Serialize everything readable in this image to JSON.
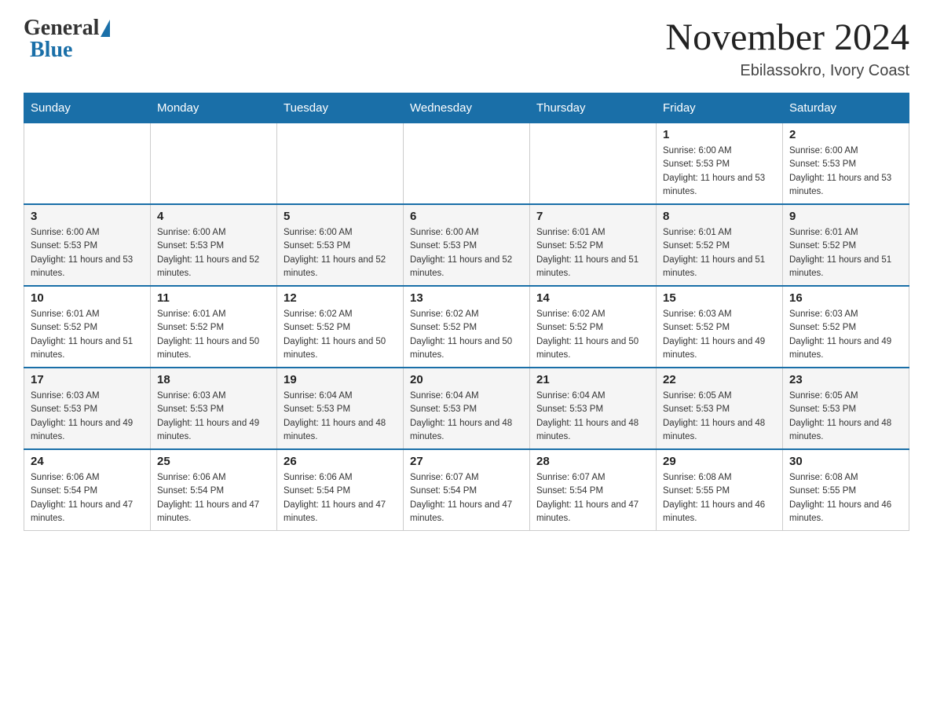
{
  "header": {
    "logo_general": "General",
    "logo_blue": "Blue",
    "month_title": "November 2024",
    "location": "Ebilassokro, Ivory Coast"
  },
  "days_of_week": [
    "Sunday",
    "Monday",
    "Tuesday",
    "Wednesday",
    "Thursday",
    "Friday",
    "Saturday"
  ],
  "weeks": [
    {
      "days": [
        {
          "num": "",
          "sunrise": "",
          "sunset": "",
          "daylight": ""
        },
        {
          "num": "",
          "sunrise": "",
          "sunset": "",
          "daylight": ""
        },
        {
          "num": "",
          "sunrise": "",
          "sunset": "",
          "daylight": ""
        },
        {
          "num": "",
          "sunrise": "",
          "sunset": "",
          "daylight": ""
        },
        {
          "num": "",
          "sunrise": "",
          "sunset": "",
          "daylight": ""
        },
        {
          "num": "1",
          "sunrise": "Sunrise: 6:00 AM",
          "sunset": "Sunset: 5:53 PM",
          "daylight": "Daylight: 11 hours and 53 minutes."
        },
        {
          "num": "2",
          "sunrise": "Sunrise: 6:00 AM",
          "sunset": "Sunset: 5:53 PM",
          "daylight": "Daylight: 11 hours and 53 minutes."
        }
      ]
    },
    {
      "days": [
        {
          "num": "3",
          "sunrise": "Sunrise: 6:00 AM",
          "sunset": "Sunset: 5:53 PM",
          "daylight": "Daylight: 11 hours and 53 minutes."
        },
        {
          "num": "4",
          "sunrise": "Sunrise: 6:00 AM",
          "sunset": "Sunset: 5:53 PM",
          "daylight": "Daylight: 11 hours and 52 minutes."
        },
        {
          "num": "5",
          "sunrise": "Sunrise: 6:00 AM",
          "sunset": "Sunset: 5:53 PM",
          "daylight": "Daylight: 11 hours and 52 minutes."
        },
        {
          "num": "6",
          "sunrise": "Sunrise: 6:00 AM",
          "sunset": "Sunset: 5:53 PM",
          "daylight": "Daylight: 11 hours and 52 minutes."
        },
        {
          "num": "7",
          "sunrise": "Sunrise: 6:01 AM",
          "sunset": "Sunset: 5:52 PM",
          "daylight": "Daylight: 11 hours and 51 minutes."
        },
        {
          "num": "8",
          "sunrise": "Sunrise: 6:01 AM",
          "sunset": "Sunset: 5:52 PM",
          "daylight": "Daylight: 11 hours and 51 minutes."
        },
        {
          "num": "9",
          "sunrise": "Sunrise: 6:01 AM",
          "sunset": "Sunset: 5:52 PM",
          "daylight": "Daylight: 11 hours and 51 minutes."
        }
      ]
    },
    {
      "days": [
        {
          "num": "10",
          "sunrise": "Sunrise: 6:01 AM",
          "sunset": "Sunset: 5:52 PM",
          "daylight": "Daylight: 11 hours and 51 minutes."
        },
        {
          "num": "11",
          "sunrise": "Sunrise: 6:01 AM",
          "sunset": "Sunset: 5:52 PM",
          "daylight": "Daylight: 11 hours and 50 minutes."
        },
        {
          "num": "12",
          "sunrise": "Sunrise: 6:02 AM",
          "sunset": "Sunset: 5:52 PM",
          "daylight": "Daylight: 11 hours and 50 minutes."
        },
        {
          "num": "13",
          "sunrise": "Sunrise: 6:02 AM",
          "sunset": "Sunset: 5:52 PM",
          "daylight": "Daylight: 11 hours and 50 minutes."
        },
        {
          "num": "14",
          "sunrise": "Sunrise: 6:02 AM",
          "sunset": "Sunset: 5:52 PM",
          "daylight": "Daylight: 11 hours and 50 minutes."
        },
        {
          "num": "15",
          "sunrise": "Sunrise: 6:03 AM",
          "sunset": "Sunset: 5:52 PM",
          "daylight": "Daylight: 11 hours and 49 minutes."
        },
        {
          "num": "16",
          "sunrise": "Sunrise: 6:03 AM",
          "sunset": "Sunset: 5:52 PM",
          "daylight": "Daylight: 11 hours and 49 minutes."
        }
      ]
    },
    {
      "days": [
        {
          "num": "17",
          "sunrise": "Sunrise: 6:03 AM",
          "sunset": "Sunset: 5:53 PM",
          "daylight": "Daylight: 11 hours and 49 minutes."
        },
        {
          "num": "18",
          "sunrise": "Sunrise: 6:03 AM",
          "sunset": "Sunset: 5:53 PM",
          "daylight": "Daylight: 11 hours and 49 minutes."
        },
        {
          "num": "19",
          "sunrise": "Sunrise: 6:04 AM",
          "sunset": "Sunset: 5:53 PM",
          "daylight": "Daylight: 11 hours and 48 minutes."
        },
        {
          "num": "20",
          "sunrise": "Sunrise: 6:04 AM",
          "sunset": "Sunset: 5:53 PM",
          "daylight": "Daylight: 11 hours and 48 minutes."
        },
        {
          "num": "21",
          "sunrise": "Sunrise: 6:04 AM",
          "sunset": "Sunset: 5:53 PM",
          "daylight": "Daylight: 11 hours and 48 minutes."
        },
        {
          "num": "22",
          "sunrise": "Sunrise: 6:05 AM",
          "sunset": "Sunset: 5:53 PM",
          "daylight": "Daylight: 11 hours and 48 minutes."
        },
        {
          "num": "23",
          "sunrise": "Sunrise: 6:05 AM",
          "sunset": "Sunset: 5:53 PM",
          "daylight": "Daylight: 11 hours and 48 minutes."
        }
      ]
    },
    {
      "days": [
        {
          "num": "24",
          "sunrise": "Sunrise: 6:06 AM",
          "sunset": "Sunset: 5:54 PM",
          "daylight": "Daylight: 11 hours and 47 minutes."
        },
        {
          "num": "25",
          "sunrise": "Sunrise: 6:06 AM",
          "sunset": "Sunset: 5:54 PM",
          "daylight": "Daylight: 11 hours and 47 minutes."
        },
        {
          "num": "26",
          "sunrise": "Sunrise: 6:06 AM",
          "sunset": "Sunset: 5:54 PM",
          "daylight": "Daylight: 11 hours and 47 minutes."
        },
        {
          "num": "27",
          "sunrise": "Sunrise: 6:07 AM",
          "sunset": "Sunset: 5:54 PM",
          "daylight": "Daylight: 11 hours and 47 minutes."
        },
        {
          "num": "28",
          "sunrise": "Sunrise: 6:07 AM",
          "sunset": "Sunset: 5:54 PM",
          "daylight": "Daylight: 11 hours and 47 minutes."
        },
        {
          "num": "29",
          "sunrise": "Sunrise: 6:08 AM",
          "sunset": "Sunset: 5:55 PM",
          "daylight": "Daylight: 11 hours and 46 minutes."
        },
        {
          "num": "30",
          "sunrise": "Sunrise: 6:08 AM",
          "sunset": "Sunset: 5:55 PM",
          "daylight": "Daylight: 11 hours and 46 minutes."
        }
      ]
    }
  ]
}
